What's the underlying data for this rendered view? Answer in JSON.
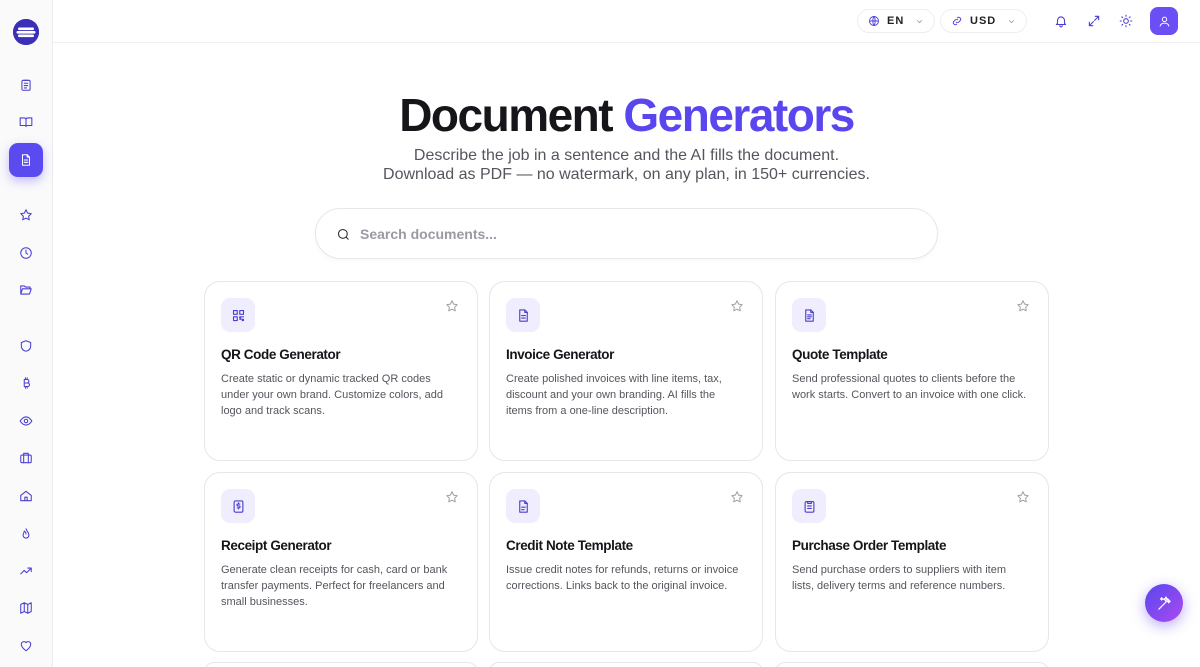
{
  "app": {
    "accent_color": "#5a46ee",
    "active_color": "#5a4bf0"
  },
  "sidebar": {
    "logo_icon": "brand-logo",
    "items": [
      {
        "icon": "clipboard-icon",
        "active": false
      },
      {
        "icon": "book-open-icon",
        "active": false
      },
      {
        "icon": "document-icon",
        "active": true
      },
      {
        "icon": "star-icon",
        "active": false
      },
      {
        "icon": "clock-icon",
        "active": false
      },
      {
        "icon": "folder-open-icon",
        "active": false
      },
      {
        "icon": "shield-icon",
        "active": false
      },
      {
        "icon": "bitcoin-icon",
        "active": false
      },
      {
        "icon": "eye-icon",
        "active": false
      },
      {
        "icon": "briefcase-icon",
        "active": false
      },
      {
        "icon": "home-icon",
        "active": false
      },
      {
        "icon": "flame-icon",
        "active": false
      },
      {
        "icon": "trending-up-icon",
        "active": false
      },
      {
        "icon": "map-icon",
        "active": false
      },
      {
        "icon": "heart-icon",
        "active": false
      }
    ]
  },
  "topbar": {
    "language": "EN",
    "currency": "USD",
    "icons": [
      "bell-icon",
      "expand-icon",
      "sun-icon",
      "user-icon"
    ]
  },
  "hero": {
    "title_part1": "Document",
    "title_part2": "Generators",
    "subtitle_line1": "Describe the job in a sentence and the AI fills the document.",
    "subtitle_line2": "Download as PDF — no watermark, on any plan, in 150+ currencies."
  },
  "search": {
    "placeholder": "Search documents..."
  },
  "cards": [
    {
      "icon": "qr-code-icon",
      "title": "QR Code Generator",
      "description": "Create static or dynamic tracked QR codes under your own brand. Customize colors, add logo and track scans."
    },
    {
      "icon": "invoice-icon",
      "title": "Invoice Generator",
      "description": "Create polished invoices with line items, tax, discount and your own branding. AI fills the items from a one-line description."
    },
    {
      "icon": "quote-document-icon",
      "title": "Quote Template",
      "description": "Send professional quotes to clients before the work starts. Convert to an invoice with one click."
    },
    {
      "icon": "receipt-icon",
      "title": "Receipt Generator",
      "description": "Generate clean receipts for cash, card or bank transfer payments. Perfect for freelancers and small businesses."
    },
    {
      "icon": "credit-note-icon",
      "title": "Credit Note Template",
      "description": "Issue credit notes for refunds, returns or invoice corrections. Links back to the original invoice."
    },
    {
      "icon": "purchase-order-icon",
      "title": "Purchase Order Template",
      "description": "Send purchase orders to suppliers with item lists, delivery terms and reference numbers."
    }
  ],
  "fab": {
    "icon": "magic-wand-icon"
  }
}
